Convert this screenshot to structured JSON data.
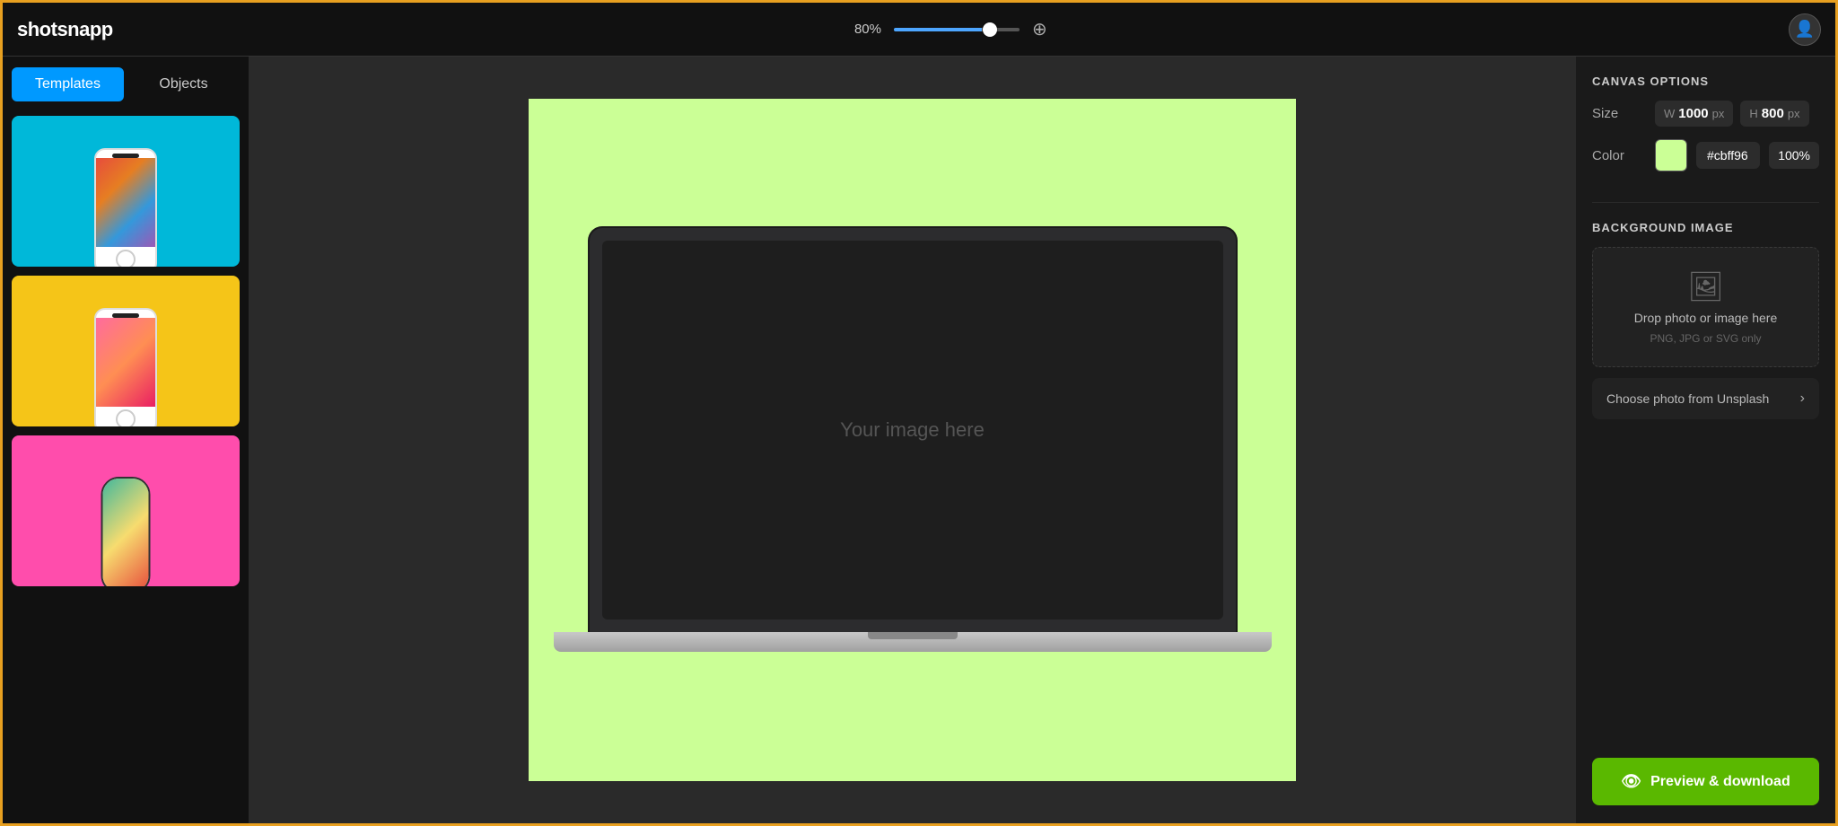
{
  "app": {
    "name": "shotsnapp"
  },
  "header": {
    "zoom_value": "80%",
    "zoom_level": 80,
    "avatar_icon": "👤"
  },
  "sidebar": {
    "tabs": [
      {
        "id": "templates",
        "label": "Templates",
        "active": true
      },
      {
        "id": "objects",
        "label": "Objects",
        "active": false
      }
    ],
    "templates": [
      {
        "id": 1,
        "bg": "#00b8d9"
      },
      {
        "id": 2,
        "bg": "#f5c518"
      },
      {
        "id": 3,
        "bg": "#ff4dac"
      }
    ]
  },
  "canvas": {
    "placeholder_text": "Your image here",
    "background_color": "#cbff96"
  },
  "right_panel": {
    "title": "CANVAS OPTIONS",
    "size": {
      "label": "Size",
      "width_label": "W",
      "width_value": "1000",
      "height_label": "H",
      "height_value": "800",
      "unit": "px"
    },
    "color": {
      "label": "Color",
      "hex_value": "#cbff96",
      "opacity_value": "100",
      "opacity_unit": "%"
    },
    "background_image": {
      "title": "BACKGROUND IMAGE",
      "drop_title": "Drop photo or image here",
      "drop_subtitle": "PNG, JPG or SVG only",
      "unsplash_label": "Choose photo from Unsplash"
    },
    "preview_btn": {
      "label": "Preview & download",
      "icon": "👁"
    }
  }
}
